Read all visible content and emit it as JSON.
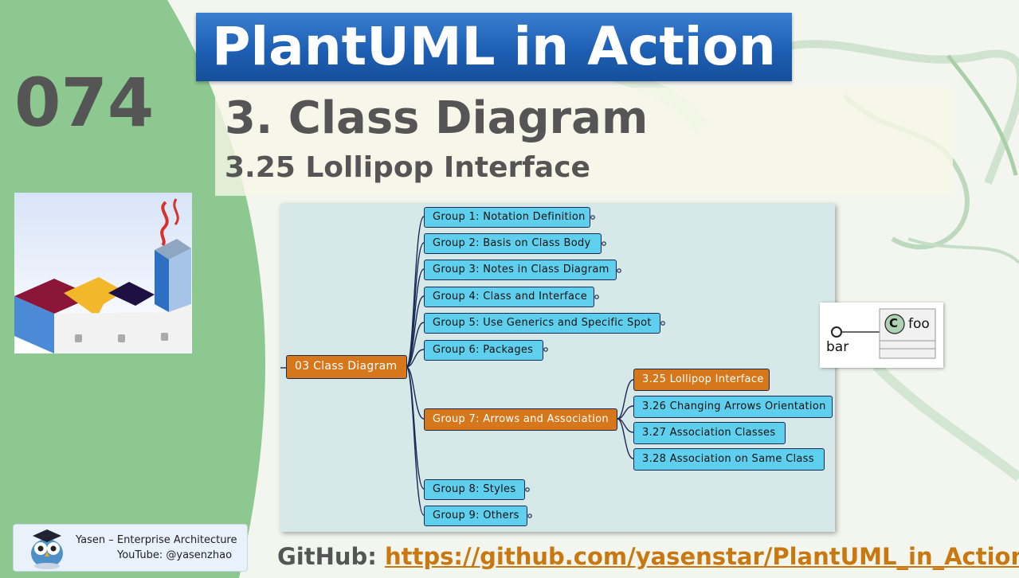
{
  "banner": {
    "title": "PlantUML in Action"
  },
  "episode": {
    "number": "074"
  },
  "section": {
    "title": "3. Class Diagram",
    "subtitle": "3.25 Lollipop Interface"
  },
  "mindmap": {
    "root": "03 Class Diagram",
    "groups": [
      "Group 1: Notation Definition",
      "Group 2: Basis on Class Body",
      "Group 3: Notes in Class Diagram",
      "Group 4: Class and Interface",
      "Group 5: Use Generics and Specific Spot",
      "Group 6: Packages",
      "Group 7: Arrows and Association",
      "Group 8: Styles",
      "Group 9: Others"
    ],
    "subtopics": [
      "3.25 Lollipop Interface",
      "3.26 Changing Arrows Orientation",
      "3.27 Association Classes",
      "3.28 Association on Same Class"
    ]
  },
  "lollipop": {
    "class_letter": "C",
    "class_name": "foo",
    "interface_name": "bar"
  },
  "author": {
    "name": "Yasen – Enterprise Architecture",
    "youtube": "YouTube: @yasenzhao"
  },
  "github": {
    "label": "GitHub: ",
    "url": "https://github.com/yasenstar/PlantUML_in_Action"
  },
  "colors": {
    "banner": "#1d5fb4",
    "node_blue": "#5ed0ee",
    "node_orange": "#d5771a",
    "green_arc": "#8cc88f"
  }
}
